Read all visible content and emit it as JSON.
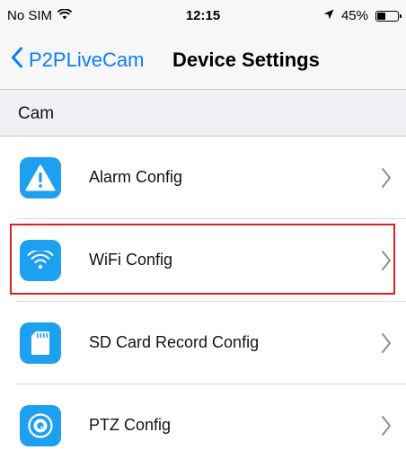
{
  "status_bar": {
    "carrier": "No SIM",
    "time": "12:15",
    "battery_percent": "45%",
    "battery_level": 0.45,
    "wifi_icon": "wifi-signal-icon",
    "location_icon": "location-arrow-icon",
    "battery_icon": "battery-icon"
  },
  "nav": {
    "back_label": "P2PLiveCam",
    "title": "Device Settings",
    "back_icon": "chevron-left-icon",
    "accent_color": "#0a7cff"
  },
  "section": {
    "title": "Cam"
  },
  "rows": [
    {
      "label": "Alarm Config",
      "icon": "alert-triangle-icon"
    },
    {
      "label": "WiFi Config",
      "icon": "wifi-icon",
      "highlighted": true
    },
    {
      "label": "SD Card Record Config",
      "icon": "sd-card-icon"
    },
    {
      "label": "PTZ Config",
      "icon": "ptz-lens-icon"
    }
  ],
  "colors": {
    "icon_background": "#1ea0f0",
    "highlight_border": "#e02020"
  }
}
